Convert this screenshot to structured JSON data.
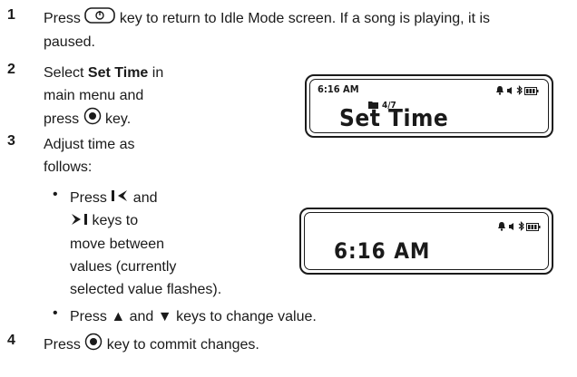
{
  "steps": [
    {
      "number": "1",
      "text_before": "Press",
      "text_after": "key to return to Idle Mode screen. If a song is playing, it is",
      "text_line2": "paused."
    },
    {
      "number": "2",
      "line1_before": "Select ",
      "line1_bold": "Set Time",
      "line1_after": " in",
      "line2": "main menu and",
      "line3_before": "press",
      "line3_after": " key."
    },
    {
      "number": "3",
      "line1": "Adjust time as",
      "line2": "follows:"
    },
    {
      "number": "4",
      "text_before": "Press",
      "text_after": " key to commit changes."
    }
  ],
  "bullets": [
    {
      "marker": "•",
      "line1_before": "Press ",
      "line1_after": " and",
      "line2_after": " keys to",
      "line3": "move between",
      "line4": "values (currently",
      "line5": "selected value flashes)."
    },
    {
      "marker": "•",
      "before": "Press ",
      "up": "▲",
      "mid": " and ",
      "down": "▼",
      "after": " keys to change value."
    }
  ],
  "screen1": {
    "time": "6:16 AM",
    "counter": "4/7",
    "title": "Set Time"
  },
  "screen2": {
    "time": "6:16 AM"
  },
  "icons": [
    "home-key-icon",
    "center-select-key-icon",
    "previous-track-key-icon",
    "next-track-key-icon",
    "bell-icon",
    "speaker-icon",
    "bluetooth-icon",
    "battery-icon",
    "folder-icon"
  ]
}
